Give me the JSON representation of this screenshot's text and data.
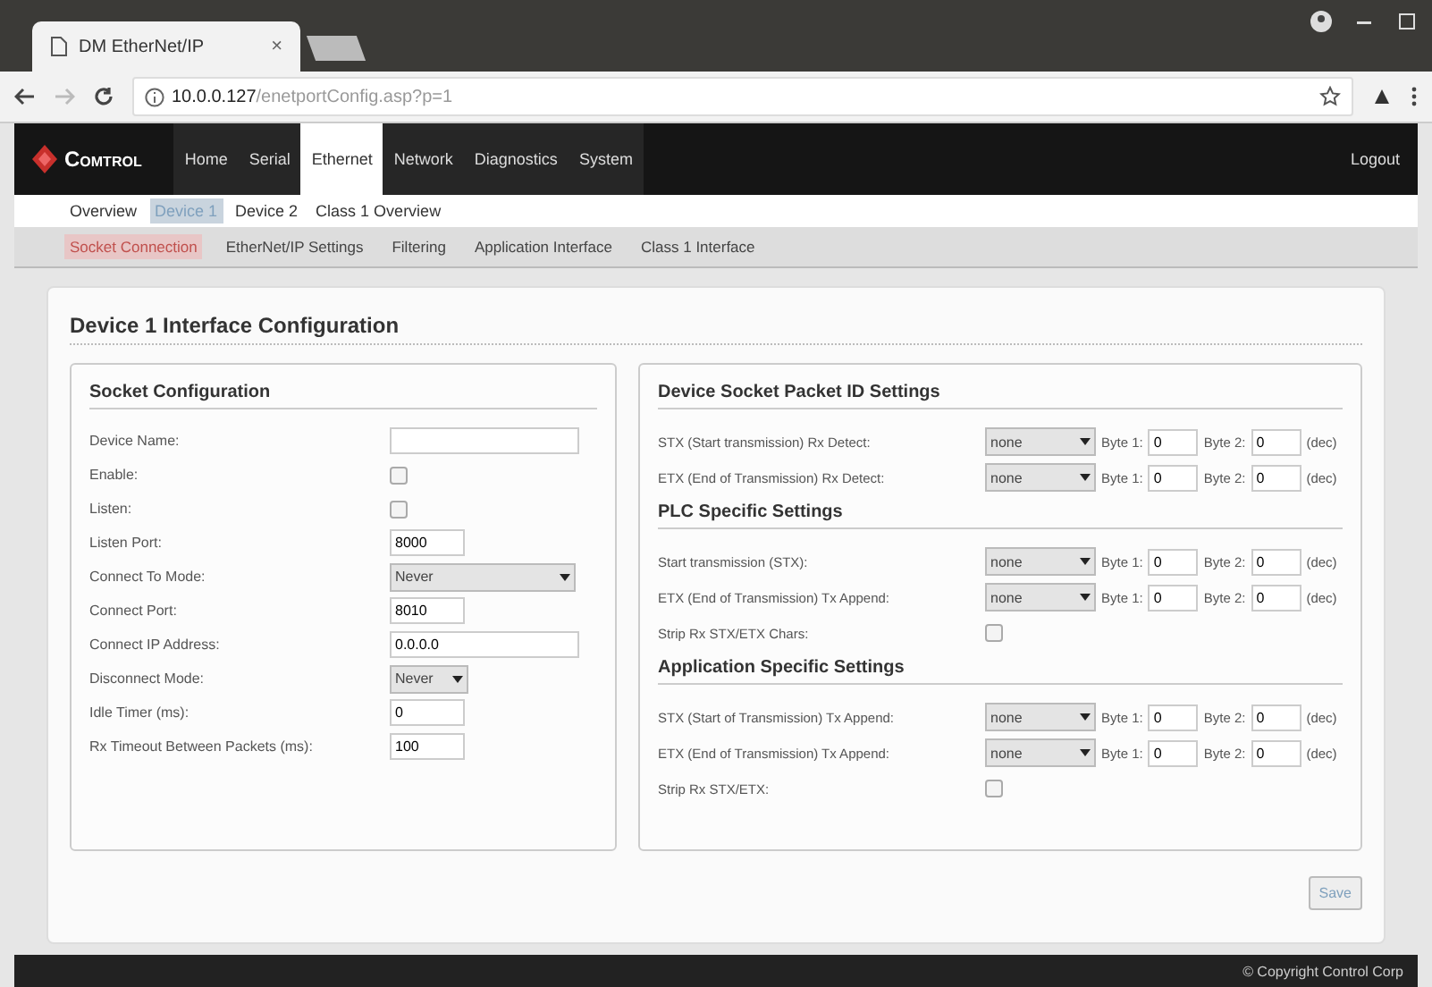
{
  "browser": {
    "tab_title": "DM EtherNet/IP",
    "tab_close": "×",
    "url_host": "10.0.0.127",
    "url_path": "/enetportConfig.asp?p=1"
  },
  "brand": "Comtrol",
  "nav": [
    {
      "label": "Home",
      "selected": false
    },
    {
      "label": "Serial",
      "selected": false
    },
    {
      "label": "Ethernet",
      "selected": true
    },
    {
      "label": "Network",
      "selected": false
    },
    {
      "label": "Diagnostics",
      "selected": false
    },
    {
      "label": "System",
      "selected": false
    }
  ],
  "logout": "Logout",
  "subnav": [
    {
      "label": "Overview",
      "selected": false
    },
    {
      "label": "Device 1",
      "selected": true
    },
    {
      "label": "Device 2",
      "selected": false
    },
    {
      "label": "Class 1 Overview",
      "selected": false
    }
  ],
  "subsubnav": [
    {
      "label": "Socket Connection",
      "selected": true
    },
    {
      "label": "EtherNet/IP Settings",
      "selected": false
    },
    {
      "label": "Filtering",
      "selected": false
    },
    {
      "label": "Application Interface",
      "selected": false
    },
    {
      "label": "Class 1 Interface",
      "selected": false
    }
  ],
  "page_title": "Device 1 Interface Configuration",
  "socket": {
    "title": "Socket Configuration",
    "rows": [
      {
        "kind": "text",
        "label": "Device Name:",
        "value": "",
        "wide": true
      },
      {
        "kind": "checkbox",
        "label": "Enable:",
        "checked": false
      },
      {
        "kind": "checkbox",
        "label": "Listen:",
        "checked": false
      },
      {
        "kind": "text",
        "label": "Listen Port:",
        "value": "8000",
        "wide": false
      },
      {
        "kind": "select",
        "label": "Connect To Mode:",
        "value": "Never",
        "wide": true
      },
      {
        "kind": "text",
        "label": "Connect Port:",
        "value": "8010",
        "wide": false
      },
      {
        "kind": "text",
        "label": "Connect IP Address:",
        "value": "0.0.0.0",
        "wide": true
      },
      {
        "kind": "select",
        "label": "Disconnect Mode:",
        "value": "Never",
        "wide": false
      },
      {
        "kind": "text",
        "label": "Idle Timer (ms):",
        "value": "0",
        "wide": false
      },
      {
        "kind": "text",
        "label": "Rx Timeout Between Packets (ms):",
        "value": "100",
        "wide": false
      }
    ]
  },
  "sections": [
    {
      "title": "Device Socket Packet ID Settings",
      "rows": [
        {
          "kind": "bytes",
          "label": "STX (Start transmission) Rx Detect:",
          "select": "none",
          "byte1_label": "Byte 1:",
          "byte1": "0",
          "byte2_label": "Byte 2:",
          "byte2": "0",
          "unit": "(dec)"
        },
        {
          "kind": "bytes",
          "label": "ETX (End of Transmission) Rx Detect:",
          "select": "none",
          "byte1_label": "Byte 1:",
          "byte1": "0",
          "byte2_label": "Byte 2:",
          "byte2": "0",
          "unit": "(dec)"
        }
      ]
    },
    {
      "title": "PLC Specific Settings",
      "rows": [
        {
          "kind": "bytes",
          "label": "Start transmission (STX):",
          "select": "none",
          "byte1_label": "Byte 1:",
          "byte1": "0",
          "byte2_label": "Byte 2:",
          "byte2": "0",
          "unit": "(dec)"
        },
        {
          "kind": "bytes",
          "label": "ETX (End of Transmission) Tx Append:",
          "select": "none",
          "byte1_label": "Byte 1:",
          "byte1": "0",
          "byte2_label": "Byte 2:",
          "byte2": "0",
          "unit": "(dec)"
        },
        {
          "kind": "checkbox",
          "label": "Strip Rx STX/ETX Chars:",
          "checked": false
        }
      ]
    },
    {
      "title": "Application Specific Settings",
      "rows": [
        {
          "kind": "bytes",
          "label": "STX (Start of Transmission) Tx Append:",
          "select": "none",
          "byte1_label": "Byte 1:",
          "byte1": "0",
          "byte2_label": "Byte 2:",
          "byte2": "0",
          "unit": "(dec)"
        },
        {
          "kind": "bytes",
          "label": "ETX (End of Transmission) Tx Append:",
          "select": "none",
          "byte1_label": "Byte 1:",
          "byte1": "0",
          "byte2_label": "Byte 2:",
          "byte2": "0",
          "unit": "(dec)"
        },
        {
          "kind": "checkbox",
          "label": "Strip Rx STX/ETX:",
          "checked": false
        }
      ]
    }
  ],
  "save": "Save",
  "footer": "© Copyright Control Corp"
}
